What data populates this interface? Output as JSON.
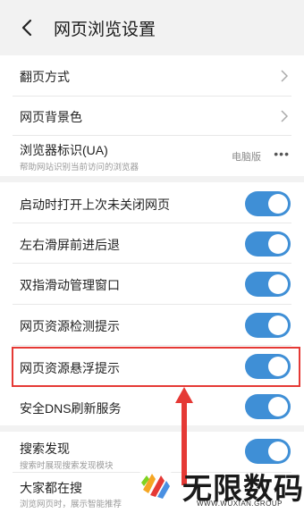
{
  "header": {
    "title": "网页浏览设置"
  },
  "group1": {
    "page_turn": {
      "label": "翻页方式"
    },
    "bg_color": {
      "label": "网页背景色"
    },
    "ua": {
      "label": "浏览器标识(UA)",
      "sub": "帮助网站识别当前访问的浏览器",
      "value": "电脑版",
      "more": "•••"
    }
  },
  "group2": {
    "items": [
      {
        "label": "启动时打开上次未关闭网页",
        "on": true
      },
      {
        "label": "左右滑屏前进后退",
        "on": true
      },
      {
        "label": "双指滑动管理窗口",
        "on": true
      },
      {
        "label": "网页资源检测提示",
        "on": true
      },
      {
        "label": "网页资源悬浮提示",
        "on": true
      },
      {
        "label": "安全DNS刷新服务",
        "on": true
      }
    ]
  },
  "group3": {
    "search_discover": {
      "label": "搜索发现",
      "sub": "搜索时展现搜索发现模块",
      "on": true
    },
    "everyone_search": {
      "label": "大家都在搜",
      "sub": "浏览网页时，展示智能推荐"
    }
  },
  "watermark": {
    "name": "无限数码",
    "url": "WWW.WUXIAN.GROUP"
  },
  "colors": {
    "toggle_on": "#3f8fd6",
    "highlight": "#e53935"
  }
}
